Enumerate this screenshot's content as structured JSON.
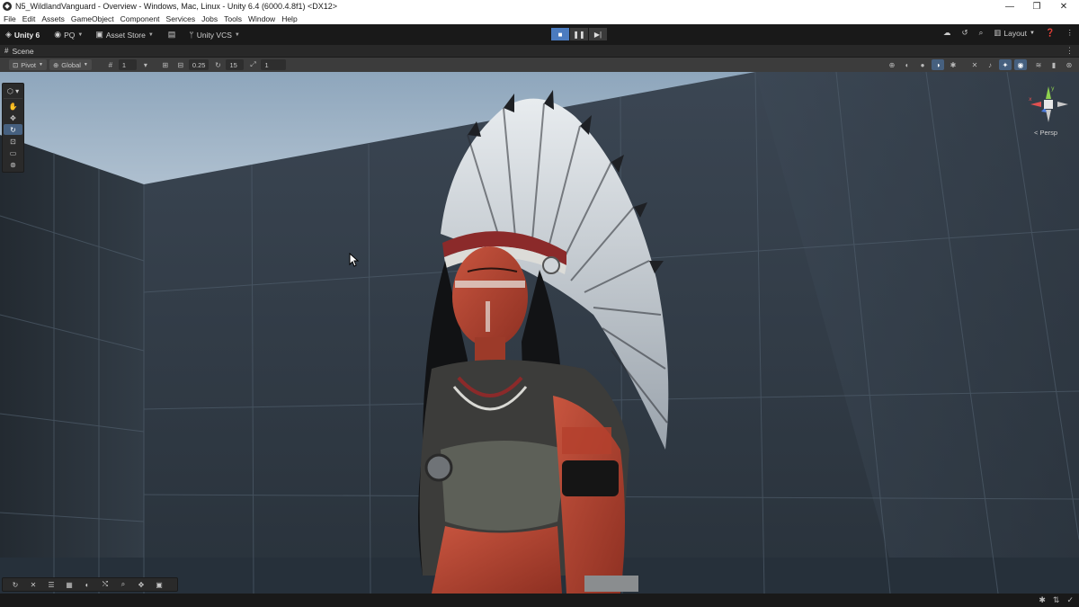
{
  "window": {
    "title": "N5_WildlandVanguard - Overview - Windows, Mac, Linux - Unity 6.4 (6000.4.8f1) <DX12>",
    "minimize_glyph": "—",
    "restore_glyph": "❐",
    "close_glyph": "✕"
  },
  "menu": {
    "items": [
      "File",
      "Edit",
      "Assets",
      "GameObject",
      "Component",
      "Services",
      "Jobs",
      "Tools",
      "Window",
      "Help"
    ]
  },
  "toolbar": {
    "unity_label": "Unity 6",
    "account_label": "PQ",
    "asset_store_label": "Asset Store",
    "vcs_label": "Unity VCS",
    "layout_label": "Layout",
    "play_glyph": "■",
    "pause_glyph": "❚❚",
    "step_glyph": "▶|"
  },
  "scene_tab": {
    "label": "Scene",
    "more_glyph": "⋮"
  },
  "scene_toolbar": {
    "pivot_label": "Pivot",
    "global_label": "Global",
    "grid_value": "1",
    "snap_value": "0.25",
    "rotate_snap_value": "15",
    "scale_snap_value": "1"
  },
  "gizmo": {
    "projection_label": "< Persp",
    "axis_y": "y",
    "axis_x": "x"
  },
  "tools": [
    "view",
    "move",
    "rotate",
    "scale",
    "rect",
    "transform"
  ],
  "colors": {
    "accent_blue": "#4b7bbf",
    "panel": "#3c3c3c",
    "sky": "#a9bccd",
    "wall": "#37424e"
  }
}
